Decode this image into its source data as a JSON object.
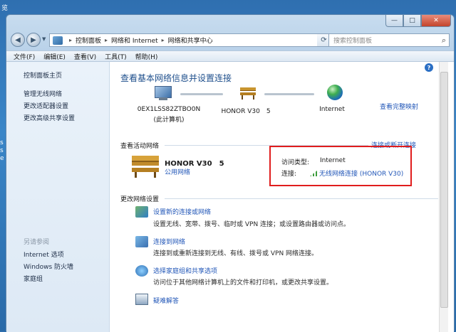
{
  "desktop": {
    "corner_text": "览",
    "side_text": "s\ns e"
  },
  "window": {
    "controls": {
      "minimize": "—",
      "maximize": "□",
      "close": "✕"
    },
    "address": {
      "crumbs": [
        "控制面板",
        "网络和 Internet",
        "网络和共享中心"
      ],
      "search_placeholder": "搜索控制面板"
    },
    "menu": [
      "文件(F)",
      "编辑(E)",
      "查看(V)",
      "工具(T)",
      "帮助(H)"
    ]
  },
  "sidebar": {
    "home": "控制面板主页",
    "links": [
      "管理无线网络",
      "更改适配器设置",
      "更改高级共享设置"
    ],
    "see_also": "另请参阅",
    "see_also_links": [
      "Internet 选项",
      "Windows 防火墙",
      "家庭组"
    ]
  },
  "main": {
    "title": "查看基本网络信息并设置连接",
    "full_map": "查看完整映射",
    "network_map": {
      "computer_name": "0EX1LSS82ZTBO0N",
      "computer_sub": "(此计算机)",
      "network_name": "HONOR V30　5",
      "internet": "Internet"
    },
    "active_section": "查看活动网络",
    "connect_link": "连接或断开连接",
    "active": {
      "name": "HONOR V30　5",
      "type": "公用网络",
      "access_type_label": "访问类型:",
      "access_type_value": "Internet",
      "connection_label": "连接:",
      "connection_value": "无线网络连接 (HONOR V30)"
    },
    "change_section": "更改网络设置",
    "tasks": [
      {
        "title": "设置新的连接或网络",
        "desc": "设置无线、宽带、拨号、临时或 VPN 连接；或设置路由器或访问点。"
      },
      {
        "title": "连接到网络",
        "desc": "连接到或重新连接到无线、有线、拨号或 VPN 网络连接。"
      },
      {
        "title": "选择家庭组和共享选项",
        "desc": "访问位于其他网络计算机上的文件和打印机，或更改共享设置。"
      },
      {
        "title": "疑难解答",
        "desc": ""
      }
    ],
    "help": "?"
  }
}
